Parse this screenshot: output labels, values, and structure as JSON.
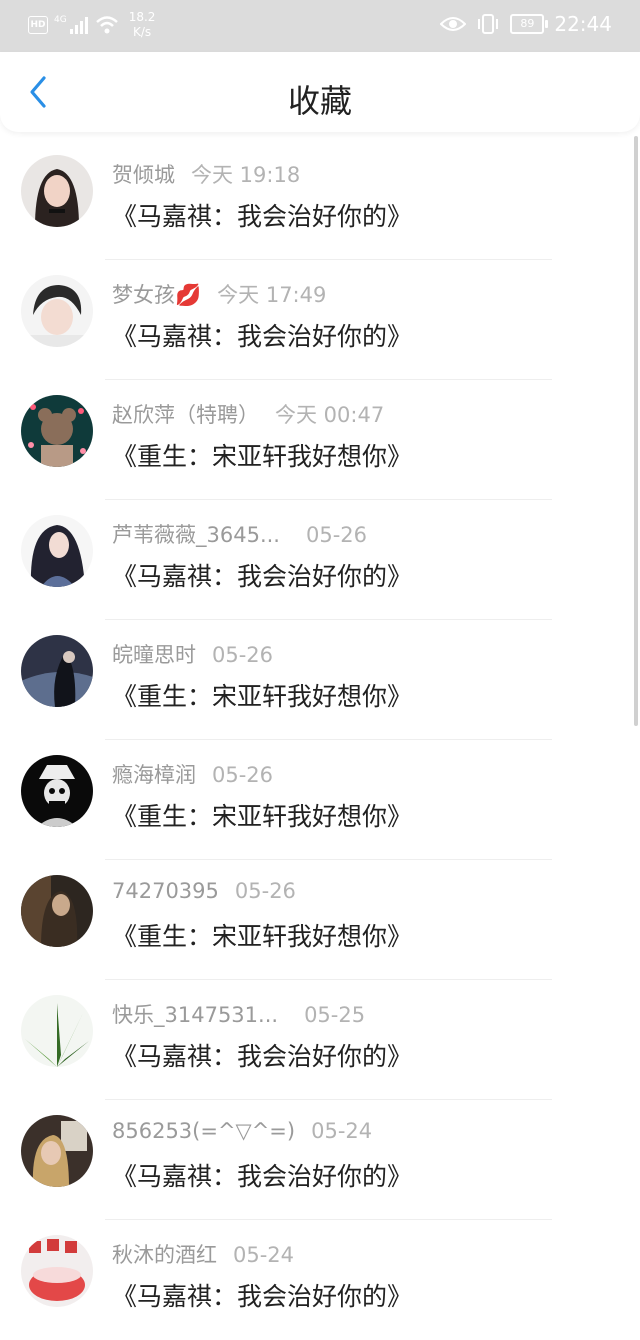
{
  "status_bar": {
    "hd": "HD",
    "network": "4G",
    "speed_value": "18.2",
    "speed_unit": "K/s",
    "battery": "89",
    "time": "22:44"
  },
  "header": {
    "title": "收藏",
    "back_icon": "chevron-left-icon"
  },
  "colors": {
    "accent": "#2a8fe6",
    "status_bar_bg": "#dcdcdc",
    "name_text": "#9a9a9a",
    "message_text": "#222222"
  },
  "items": [
    {
      "name": "贺倾城",
      "time": "今天 19:18",
      "message": "《马嘉祺：我会治好你的》"
    },
    {
      "name": "梦女孩💋",
      "time": "今天 17:49",
      "message": "《马嘉祺：我会治好你的》"
    },
    {
      "name": "赵欣萍（特聘）",
      "time": "今天 00:47",
      "message": "《重生：宋亚轩我好想你》"
    },
    {
      "name": "芦苇薇薇_3645...",
      "time": "05-26",
      "message": "《马嘉祺：我会治好你的》"
    },
    {
      "name": "皖曈思时",
      "time": "05-26",
      "message": "《重生：宋亚轩我好想你》"
    },
    {
      "name": "瘾海樟润",
      "time": "05-26",
      "message": "《重生：宋亚轩我好想你》"
    },
    {
      "name": "74270395",
      "time": "05-26",
      "message": "《重生：宋亚轩我好想你》"
    },
    {
      "name": "快乐_3147531...",
      "time": "05-25",
      "message": "《马嘉祺：我会治好你的》"
    },
    {
      "name": "856253(=^▽^=)",
      "time": "05-24",
      "message": "《马嘉祺：我会治好你的》"
    },
    {
      "name": "秋沐的酒红",
      "time": "05-24",
      "message": "《马嘉祺：我会治好你的》"
    }
  ]
}
